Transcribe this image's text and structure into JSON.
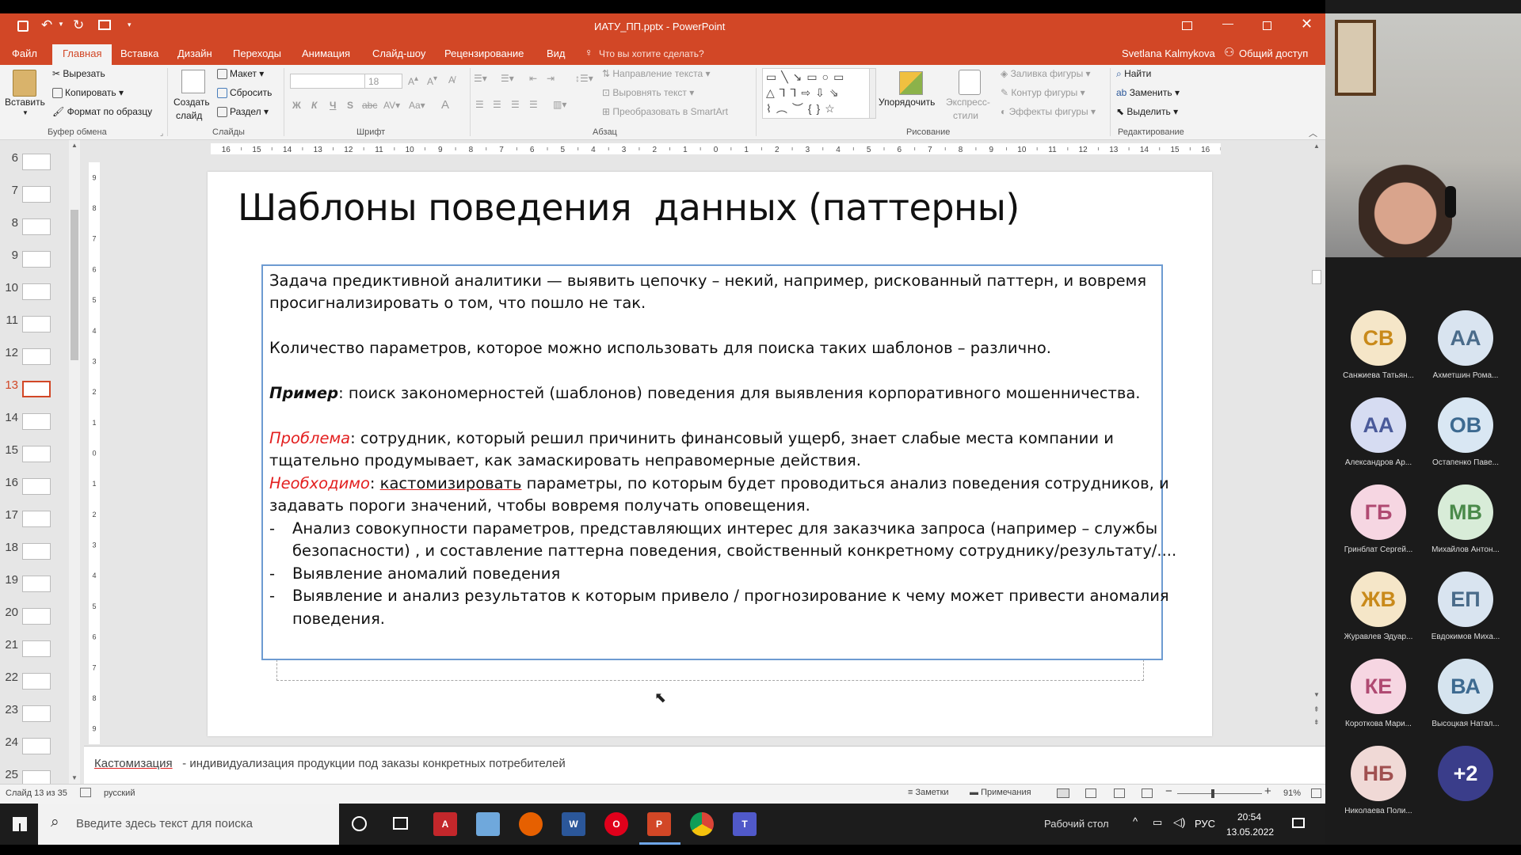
{
  "window": {
    "title": "ИАТУ_ПП.pptx - PowerPoint",
    "user": "Svetlana Kalmykova",
    "share": "Общий доступ"
  },
  "tabs": [
    "Файл",
    "Главная",
    "Вставка",
    "Дизайн",
    "Переходы",
    "Анимация",
    "Слайд-шоу",
    "Рецензирование",
    "Вид"
  ],
  "active_tab": "Главная",
  "tell_me": "Что вы хотите сделать?",
  "ribbon": {
    "clipboard": {
      "paste": "Вставить",
      "cut": "Вырезать",
      "copy": "Копировать",
      "format_painter": "Формат по образцу",
      "group": "Буфер обмена"
    },
    "slides": {
      "new_slide_1": "Создать",
      "new_slide_2": "слайд",
      "layout": "Макет",
      "reset": "Сбросить",
      "section": "Раздел",
      "group": "Слайды"
    },
    "font": {
      "size": "18",
      "group": "Шрифт"
    },
    "paragraph": {
      "text_direction": "Направление текста",
      "align_text": "Выровнять текст",
      "smartart": "Преобразовать в SmartArt",
      "group": "Абзац"
    },
    "drawing": {
      "arrange": "Упорядочить",
      "quick_styles_1": "Экспресс-",
      "quick_styles_2": "стили",
      "shape_fill": "Заливка фигуры",
      "shape_outline": "Контур фигуры",
      "shape_effects": "Эффекты фигуры",
      "group": "Рисование"
    },
    "editing": {
      "find": "Найти",
      "replace": "Заменить",
      "select": "Выделить",
      "group": "Редактирование"
    }
  },
  "ruler": {
    "labels": [
      "16",
      "15",
      "14",
      "13",
      "12",
      "11",
      "10",
      "9",
      "8",
      "7",
      "6",
      "5",
      "4",
      "3",
      "2",
      "1",
      "0",
      "1",
      "2",
      "3",
      "4",
      "5",
      "6",
      "7",
      "8",
      "9",
      "10",
      "11",
      "12",
      "13",
      "14",
      "15",
      "16"
    ],
    "vlabels": [
      "9",
      "8",
      "7",
      "6",
      "5",
      "4",
      "3",
      "2",
      "1",
      "0",
      "1",
      "2",
      "3",
      "4",
      "5",
      "6",
      "7",
      "8",
      "9"
    ]
  },
  "thumbnails": [
    "6",
    "7",
    "8",
    "9",
    "10",
    "11",
    "12",
    "13",
    "14",
    "15",
    "16",
    "17",
    "18",
    "19",
    "20",
    "21",
    "22",
    "23",
    "24",
    "25"
  ],
  "current_slide": "13",
  "slide": {
    "title": "Шаблоны поведения  данных (паттерны)",
    "p1a": "Задача предиктивной аналитики — выявить цепочку – некий, например, рискованный паттерн, и вовремя",
    "p1b": "просигнализировать о том, что пошло не так.",
    "p2": "Количество параметров, которое можно использовать для поиска таких шаблонов – различно.",
    "p3_label": "Пример",
    "p3_text": ": поиск закономерностей (шаблонов) поведения для выявления корпоративного мошенничества.",
    "p4_label": "Проблема",
    "p4_text": ": сотрудник, который решил причинить финансовый ущерб, знает слабые места компании и",
    "p4b": "тщательно продумывает, как замаскировать неправомерные действия.",
    "p5_label": "Необходимо",
    "p5_sep": ": ",
    "p5_link": "кастомизировать",
    "p5_text": " параметры, по которым будет проводиться анализ поведения сотрудников, и",
    "p5b": "задавать пороги значений, чтобы вовремя получать оповещения.",
    "bullet_mark": "-",
    "b1a": "Анализ совокупности параметров, представляющих интерес для заказчика запроса (например – службы",
    "b1b": "безопасности) , и составление паттерна поведения, свойственный конкретному сотруднику/результату/....",
    "b2": "Выявление аномалий поведения",
    "b3a": "Выявление и анализ результатов к которым привело / прогнозирование к чему может привести аномалия",
    "b3b": "поведения."
  },
  "notes": {
    "term": "Кастомизация",
    "text": " - индивидуализация продукции под заказы конкретных потребителей"
  },
  "status": {
    "slide_info": "Слайд 13 из 35",
    "language": "русский",
    "notes_btn": "Заметки",
    "comments_btn": "Примечания",
    "zoom": "91%"
  },
  "taskbar": {
    "search_placeholder": "Введите здесь текст для поиска",
    "desktop": "Рабочий стол",
    "lang": "РУС",
    "time": "20:54",
    "date": "13.05.2022"
  },
  "participants": [
    {
      "initials": "СВ",
      "name": "Санжиева Татьян...",
      "bg": "#f5e6c8",
      "fg": "#c98a1a"
    },
    {
      "initials": "АА",
      "name": "Ахметшин Рома...",
      "bg": "#d9e4f0",
      "fg": "#4a6b8a"
    },
    {
      "initials": "АА",
      "name": "Александров Ар...",
      "bg": "#d6dcf2",
      "fg": "#4a5a9a"
    },
    {
      "initials": "ОВ",
      "name": "Остапенко Паве...",
      "bg": "#d9e7f3",
      "fg": "#3d6a90"
    },
    {
      "initials": "ГБ",
      "name": "Гринблат Сергей...",
      "bg": "#f6d6e2",
      "fg": "#b04a72"
    },
    {
      "initials": "МВ",
      "name": "Михайлов Антон...",
      "bg": "#d8ecd8",
      "fg": "#4a8a4a"
    },
    {
      "initials": "ЖВ",
      "name": "Журавлев Эдуар...",
      "bg": "#f5e6c8",
      "fg": "#c98a1a"
    },
    {
      "initials": "ЕП",
      "name": "Евдокимов Миха...",
      "bg": "#d9e4f0",
      "fg": "#4a6b8a"
    },
    {
      "initials": "КЕ",
      "name": "Короткова Мари...",
      "bg": "#f6d6e2",
      "fg": "#b04a72"
    },
    {
      "initials": "ВА",
      "name": "Высоцкая Натал...",
      "bg": "#d6e4ef",
      "fg": "#3d6a90"
    },
    {
      "initials": "НБ",
      "name": "Николаева Поли...",
      "bg": "#f0d9d6",
      "fg": "#a05050"
    },
    {
      "initials": "+2",
      "name": "",
      "bg": "#3a3d8a",
      "fg": "#ffffff"
    }
  ],
  "colors": {
    "accent": "#d24726",
    "problem_red": "#e32020",
    "selection": "#6d9bd1"
  }
}
